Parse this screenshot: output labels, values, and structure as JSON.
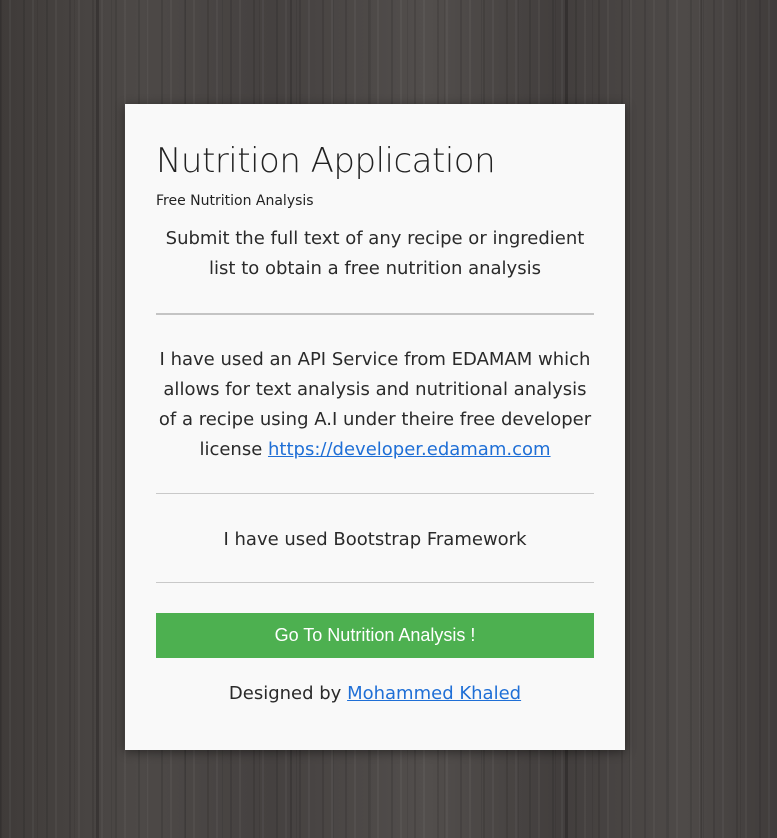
{
  "card": {
    "title": "Nutrition Application",
    "subtitle": "Free Nutrition Analysis",
    "lead": "Submit the full text of any recipe or ingredient list to obtain a free nutrition analysis",
    "api_text": "I have used an API Service from EDAMAM which allows for text analysis and nutritional analysis of a recipe using A.I under theire free developer license",
    "api_link": "https://developer.edamam.com",
    "bootstrap_text": "I have used Bootstrap Framework",
    "cta_label": "Go To Nutrition Analysis !",
    "footer_prefix": "Designed by",
    "footer_author": "Mohammed Khaled"
  },
  "colors": {
    "background": "#4a4644",
    "card": "#f9f9f9",
    "cta": "#4db050",
    "link": "#1f6fd6"
  }
}
